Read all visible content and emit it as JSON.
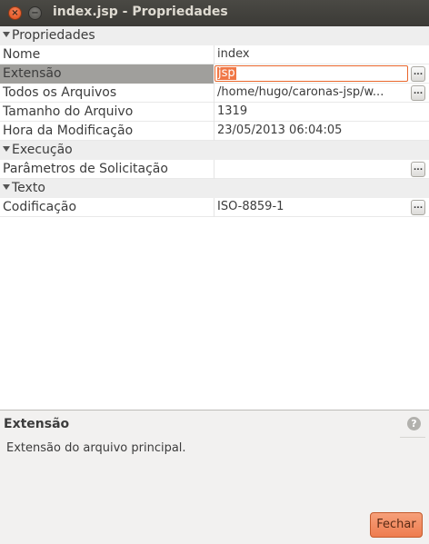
{
  "window": {
    "title": "index.jsp - Propriedades",
    "close_glyph": "×",
    "minimize_glyph": "−"
  },
  "sections": [
    {
      "label": "Propriedades"
    },
    {
      "label": "Execução"
    },
    {
      "label": "Texto"
    }
  ],
  "properties": {
    "nome": {
      "label": "Nome",
      "value": "index"
    },
    "extensao": {
      "label": "Extensão",
      "value": "jsp"
    },
    "arquivos": {
      "label": "Todos os Arquivos",
      "value": "/home/hugo/caronas-jsp/w..."
    },
    "tamanho": {
      "label": "Tamanho do Arquivo",
      "value": "1319"
    },
    "hora": {
      "label": "Hora da Modificação",
      "value": "23/05/2013 06:04:05"
    },
    "parametros": {
      "label": "Parâmetros de Solicitação",
      "value": ""
    },
    "codificacao": {
      "label": "Codificação",
      "value": "ISO-8859-1"
    }
  },
  "ellipsis_label": "...",
  "description": {
    "title": "Extensão",
    "text": "Extensão do arquivo principal.",
    "help_glyph": "?"
  },
  "buttons": {
    "close_label": "Fechar"
  },
  "colors": {
    "accent": "#ee7c4f",
    "selection": "#a09f9c",
    "titlebar": "#3c3b37"
  }
}
